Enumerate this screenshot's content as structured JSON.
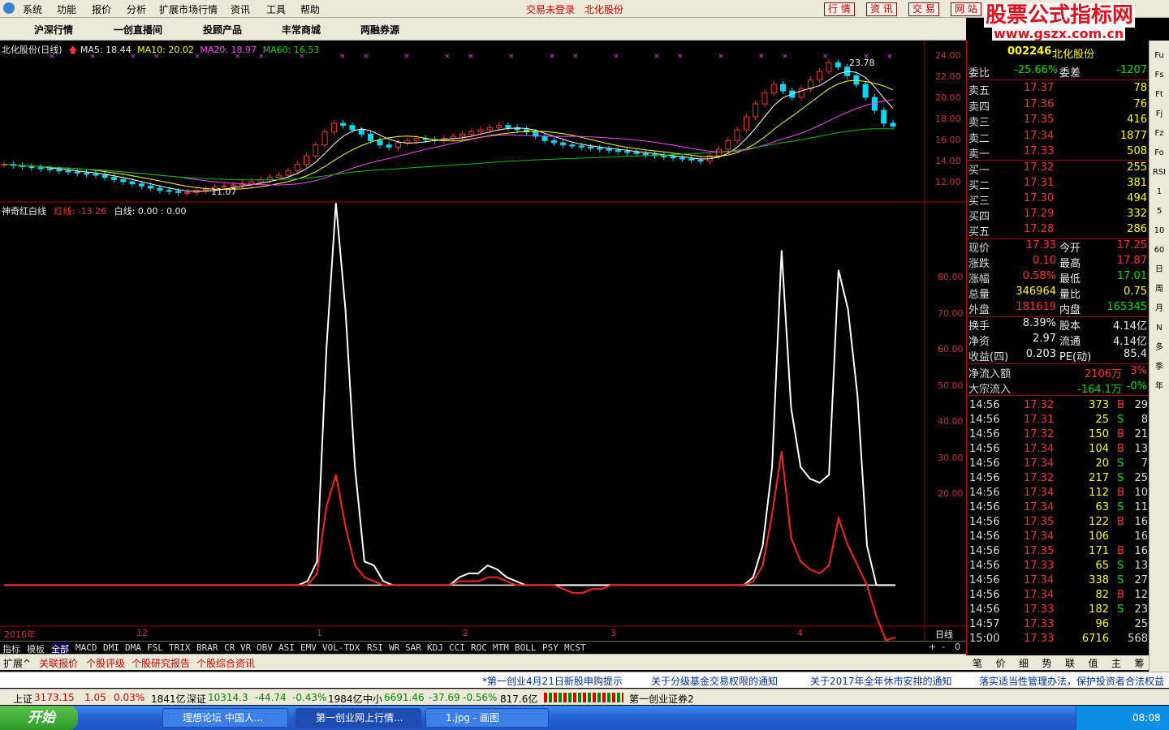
{
  "menubar": {
    "items": [
      "系统",
      "功能",
      "报价",
      "分析",
      "扩展市场行情",
      "资讯",
      "工具",
      "帮助"
    ],
    "status_login": "交易未登录",
    "status_stock": "北化股份",
    "right_buttons": [
      "行 情",
      "资 讯",
      "交 易",
      "网 站"
    ]
  },
  "brand": {
    "title": "股票公式指标网",
    "url": "www.gszx.com.cn"
  },
  "tabbar": {
    "tabs": [
      "沪深行情",
      "一创直播间",
      "投顾产品",
      "丰常商城",
      "两融券源"
    ]
  },
  "kline": {
    "header_title": "北化股份(日线)",
    "ma5": "MA5: 18.44",
    "ma10": "MA10: 20.02",
    "ma20": "MA20: 18.97",
    "ma60": "MA60: 16.53",
    "high_label": "23.78",
    "low_label": "11.07",
    "price_ticks": [
      "24.00",
      "22.00",
      "20.00",
      "18.00",
      "16.00",
      "14.00",
      "12.00"
    ]
  },
  "indicator": {
    "title": "神奇红白线",
    "red_label": "红线: -13.26",
    "white_label": "白线: 0.00 : 0.00",
    "ticks": [
      "80.00",
      "70.00",
      "60.00",
      "50.00",
      "40.00",
      "30.00",
      "20.00"
    ]
  },
  "xaxis": {
    "labels": [
      "2016年",
      "12",
      "1",
      "2",
      "3",
      "4"
    ],
    "period": "日线"
  },
  "indicator_tabs": [
    "指标",
    "模板",
    "全部",
    "MACD",
    "DMI",
    "DMA",
    "FSL",
    "TRIX",
    "BRAR",
    "CR",
    "VR",
    "OBV",
    "ASI",
    "EMV",
    "VOL-TDX",
    "RSI",
    "WR",
    "SAR",
    "KDJ",
    "CCI",
    "ROC",
    "MTM",
    "BOLL",
    "PSY",
    "MCST"
  ],
  "indicator_controls": [
    "+",
    "-",
    "0"
  ],
  "ext_tabs": [
    "扩展^",
    "关联报价",
    "个股评级",
    "个股研究报告",
    "个股综合资讯"
  ],
  "quote": {
    "code": "002246",
    "name": "北化股份",
    "webi_label": "委比",
    "webi_value": "-25.66%",
    "weicha_label": "委差",
    "weicha_value": "-1207",
    "sell": [
      {
        "label": "卖五",
        "price": "17.37",
        "vol": "78"
      },
      {
        "label": "卖四",
        "price": "17.36",
        "vol": "76"
      },
      {
        "label": "卖三",
        "price": "17.35",
        "vol": "416"
      },
      {
        "label": "卖二",
        "price": "17.34",
        "vol": "1877"
      },
      {
        "label": "卖一",
        "price": "17.33",
        "vol": "508"
      }
    ],
    "buy": [
      {
        "label": "买一",
        "price": "17.32",
        "vol": "255"
      },
      {
        "label": "买二",
        "price": "17.31",
        "vol": "381"
      },
      {
        "label": "买三",
        "price": "17.30",
        "vol": "494"
      },
      {
        "label": "买四",
        "price": "17.29",
        "vol": "332"
      },
      {
        "label": "买五",
        "price": "17.28",
        "vol": "286"
      }
    ],
    "stats": [
      {
        "l1": "现价",
        "v1": "17.33",
        "c1": "red",
        "l2": "今开",
        "v2": "17.25",
        "c2": "red"
      },
      {
        "l1": "涨跌",
        "v1": "0.10",
        "c1": "red",
        "l2": "最高",
        "v2": "17.87",
        "c2": "red"
      },
      {
        "l1": "涨幅",
        "v1": "0.58%",
        "c1": "red",
        "l2": "最低",
        "v2": "17.01",
        "c2": "green"
      },
      {
        "l1": "总量",
        "v1": "346964",
        "c1": "yellow",
        "l2": "量比",
        "v2": "0.75",
        "c2": "yellow"
      },
      {
        "l1": "外盘",
        "v1": "181619",
        "c1": "red",
        "l2": "内盘",
        "v2": "165345",
        "c2": "green"
      }
    ],
    "stats2": [
      {
        "l1": "换手",
        "v1": "8.39%",
        "l2": "股本",
        "v2": "4.14亿"
      },
      {
        "l1": "净资",
        "v1": "2.97",
        "l2": "流通",
        "v2": "4.14亿"
      },
      {
        "l1": "收益(四)",
        "v1": "0.203",
        "l2": "PE(动)",
        "v2": "85.4"
      }
    ],
    "flow": [
      {
        "label": "净流入额",
        "value": "2106万",
        "pct": "3%",
        "color": "red"
      },
      {
        "label": "大宗流入",
        "value": "-164.1万",
        "pct": "-0%",
        "color": "green"
      }
    ],
    "trades": [
      {
        "t": "14:56",
        "p": "17.32",
        "pc": "red",
        "v": "373",
        "bs": "B",
        "n": "29"
      },
      {
        "t": "14:56",
        "p": "17.31",
        "pc": "red",
        "v": "25",
        "bs": "S",
        "n": "8"
      },
      {
        "t": "14:56",
        "p": "17.32",
        "pc": "red",
        "v": "150",
        "bs": "B",
        "n": "21"
      },
      {
        "t": "14:56",
        "p": "17.34",
        "pc": "red",
        "v": "104",
        "bs": "B",
        "n": "13"
      },
      {
        "t": "14:56",
        "p": "17.34",
        "pc": "red",
        "v": "20",
        "bs": "S",
        "n": "7"
      },
      {
        "t": "14:56",
        "p": "17.32",
        "pc": "red",
        "v": "217",
        "bs": "S",
        "n": "25"
      },
      {
        "t": "14:56",
        "p": "17.34",
        "pc": "red",
        "v": "112",
        "bs": "B",
        "n": "10"
      },
      {
        "t": "14:56",
        "p": "17.34",
        "pc": "red",
        "v": "63",
        "bs": "S",
        "n": "11"
      },
      {
        "t": "14:56",
        "p": "17.35",
        "pc": "red",
        "v": "122",
        "bs": "B",
        "n": "16"
      },
      {
        "t": "14:56",
        "p": "17.34",
        "pc": "red",
        "v": "106",
        "bs": "",
        "n": "16"
      },
      {
        "t": "14:56",
        "p": "17.35",
        "pc": "red",
        "v": "171",
        "bs": "B",
        "n": "16"
      },
      {
        "t": "14:56",
        "p": "17.33",
        "pc": "red",
        "v": "65",
        "bs": "S",
        "n": "13"
      },
      {
        "t": "14:56",
        "p": "17.34",
        "pc": "red",
        "v": "338",
        "bs": "S",
        "n": "27"
      },
      {
        "t": "14:56",
        "p": "17.34",
        "pc": "red",
        "v": "82",
        "bs": "B",
        "n": "12"
      },
      {
        "t": "14:56",
        "p": "17.33",
        "pc": "red",
        "v": "182",
        "bs": "S",
        "n": "23"
      },
      {
        "t": "14:57",
        "p": "17.33",
        "pc": "red",
        "v": "96",
        "bs": "",
        "n": "25"
      },
      {
        "t": "15:00",
        "p": "17.33",
        "pc": "red",
        "v": "6716",
        "bs": "",
        "n": "568"
      }
    ],
    "bottom_tabs": [
      "笔",
      "价",
      "细",
      "势",
      "联",
      "值",
      "主",
      "筹"
    ]
  },
  "sidebar": [
    "Fu",
    "Fs",
    "Ft",
    "Fj",
    "Fz",
    "Fo",
    "RSI",
    "1",
    "5",
    "10",
    "60",
    "日",
    "周",
    "月",
    "N",
    "多",
    "季",
    "年"
  ],
  "news": [
    "*第一创业4月21日新股申购提示",
    "关于分级基金交易权限的通知",
    "关于2017年全年休市安排的通知",
    "落实适当性管理办法，保护投资者合法权益"
  ],
  "index_bar": {
    "sh_label": "上证",
    "sh_value": "3173.15",
    "sh_chg": "1.05",
    "sh_pct": "0.03%",
    "sh_amt": "1841亿",
    "sz_label": "深证",
    "sz_value": "10314.3",
    "sz_chg": "-44.74",
    "sz_pct": "-0.43%",
    "sz_amt": "1984亿",
    "zx_label": "中小",
    "zx_value": "6691.46",
    "zx_chg": "-37.69",
    "zx_pct": "-0.56%",
    "zx_amt": "817.6亿",
    "broker": "第一创业证券2"
  },
  "taskbar": {
    "start": "开始",
    "tasks": [
      "理想论坛 中国人...",
      "第一创业网上行情...",
      "1.jpg - 画图"
    ],
    "clock": "08:08"
  },
  "chart_data": [
    {
      "type": "candlestick",
      "title": "北化股份(日线)",
      "x": [
        "2016年",
        "12",
        "1",
        "2",
        "3",
        "4"
      ],
      "ylim": [
        11,
        24.5
      ],
      "close": [
        13.8,
        13.7,
        13.6,
        13.5,
        13.4,
        13.3,
        13.2,
        13.1,
        13.0,
        12.9,
        12.8,
        12.6,
        12.4,
        12.2,
        12.0,
        11.8,
        11.6,
        11.4,
        11.3,
        11.2,
        11.2,
        11.4,
        11.5,
        11.7,
        11.8,
        11.9,
        12.0,
        12.2,
        12.4,
        12.6,
        12.8,
        13.2,
        13.8,
        14.6,
        15.6,
        16.8,
        17.6,
        17.4,
        17.0,
        16.6,
        16.0,
        15.6,
        15.4,
        15.8,
        16.0,
        16.2,
        16.1,
        16.0,
        16.2,
        16.4,
        16.6,
        16.8,
        17.0,
        17.2,
        17.4,
        17.2,
        17.0,
        16.8,
        16.4,
        16.0,
        15.8,
        15.6,
        15.5,
        15.4,
        15.3,
        15.2,
        15.1,
        15.0,
        14.9,
        14.8,
        14.7,
        14.6,
        14.5,
        14.4,
        14.3,
        14.2,
        14.1,
        14.6,
        15.2,
        16.0,
        17.0,
        18.2,
        19.4,
        20.4,
        21.2,
        20.6,
        20.0,
        20.8,
        21.6,
        22.4,
        23.2,
        22.8,
        22.0,
        21.2,
        20.0,
        18.8,
        17.6,
        17.33
      ],
      "series": [
        {
          "name": "MA5",
          "values": [
            18.44
          ]
        },
        {
          "name": "MA10",
          "values": [
            20.02
          ]
        },
        {
          "name": "MA20",
          "values": [
            18.97
          ]
        },
        {
          "name": "MA60",
          "values": [
            16.53
          ]
        }
      ]
    },
    {
      "type": "line",
      "title": "神奇红白线",
      "ylim": [
        -10,
        95
      ],
      "series": [
        {
          "name": "白线",
          "color": "#ffffff",
          "values": [
            0,
            0,
            0,
            0,
            0,
            0,
            0,
            0,
            0,
            0,
            0,
            0,
            0,
            0,
            0,
            0,
            0,
            0,
            0,
            0,
            0,
            0,
            0,
            0,
            0,
            0,
            0,
            0,
            0,
            0,
            0,
            0,
            1,
            6,
            60,
            97,
            70,
            30,
            6,
            5,
            1,
            0,
            0,
            0,
            0,
            0,
            0,
            0,
            2,
            3,
            3,
            5,
            4,
            2,
            1,
            0,
            0,
            0,
            0,
            0,
            0,
            0,
            0,
            0,
            0,
            0,
            0,
            0,
            0,
            0,
            0,
            0,
            0,
            0,
            0,
            0,
            0,
            0,
            0,
            2,
            10,
            30,
            85,
            45,
            30,
            27,
            26,
            28,
            80,
            70,
            48,
            10,
            0,
            0,
            0
          ]
        },
        {
          "name": "红线",
          "color": "#ff2020",
          "values": [
            0,
            0,
            0,
            0,
            0,
            0,
            0,
            0,
            0,
            0,
            0,
            0,
            0,
            0,
            0,
            0,
            0,
            0,
            0,
            0,
            0,
            0,
            0,
            0,
            0,
            0,
            0,
            0,
            0,
            0,
            0,
            0,
            0,
            3,
            20,
            28,
            15,
            5,
            2,
            1,
            0,
            0,
            0,
            0,
            0,
            0,
            0,
            0,
            1,
            1,
            1,
            2,
            2,
            1,
            0,
            0,
            0,
            0,
            0,
            -1,
            -2,
            -2,
            -1,
            -1,
            0,
            0,
            0,
            0,
            0,
            0,
            0,
            0,
            0,
            0,
            0,
            0,
            0,
            0,
            0,
            1,
            5,
            18,
            34,
            12,
            6,
            4,
            3,
            5,
            17,
            10,
            5,
            0,
            -8,
            -14,
            -13.26
          ]
        }
      ]
    }
  ]
}
